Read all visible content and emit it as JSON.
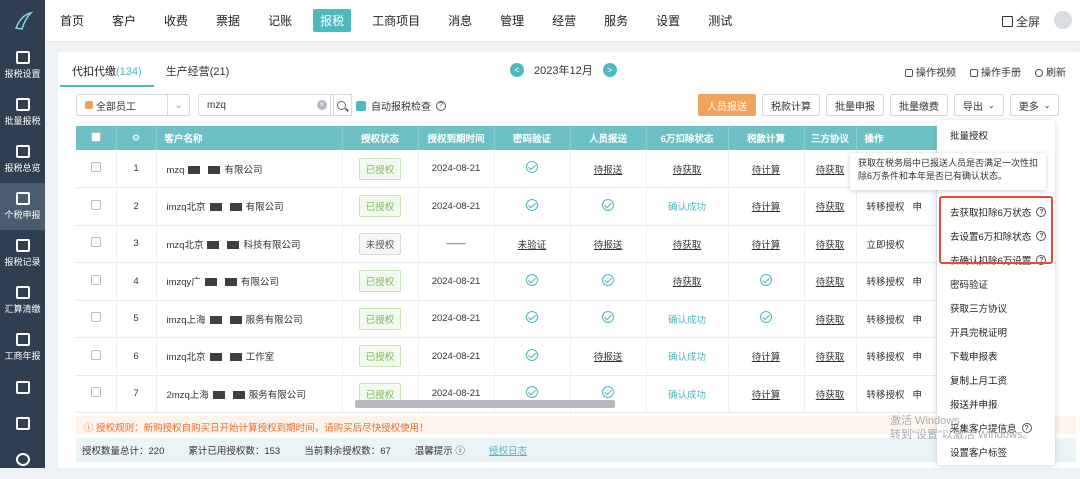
{
  "sidebar": {
    "items": [
      {
        "label": "报税设置",
        "icon": "monitor-gear-icon"
      },
      {
        "label": "批量报税",
        "icon": "monitor-download-icon"
      },
      {
        "label": "报税总览",
        "icon": "document-icon"
      },
      {
        "label": "个税申报",
        "icon": "person-tax-icon"
      },
      {
        "label": "报税记录",
        "icon": "record-list-icon"
      },
      {
        "label": "汇算清缴",
        "icon": "calculator-icon"
      },
      {
        "label": "工商年报",
        "icon": "calendar-report-icon"
      },
      {
        "label": "",
        "icon": "terminal-icon"
      },
      {
        "label": "",
        "icon": "download-icon"
      },
      {
        "label": "",
        "icon": "headset-icon"
      }
    ]
  },
  "topnav": {
    "items": [
      "首页",
      "客户",
      "收费",
      "票据",
      "记账",
      "报税",
      "工商项目",
      "消息",
      "管理",
      "经营",
      "服务",
      "设置",
      "测试"
    ],
    "active_index": 5,
    "fullscreen_label": "全屏"
  },
  "tabs": [
    {
      "label": "代扣代缴",
      "count": "(134)"
    },
    {
      "label": "生产经营",
      "count": "(21)"
    }
  ],
  "date_nav": {
    "label": "2023年12月",
    "prev": "<",
    "next": ">"
  },
  "top_links": [
    "操作视频",
    "操作手册",
    "刷新"
  ],
  "filter": {
    "staff_select": "全部员工",
    "search_value": "mzq",
    "auto_check_label": "自动报税检查"
  },
  "buttons": {
    "report_staff": "人员报送",
    "calc_tax": "税款计算",
    "batch_declare": "批量申报",
    "batch_pay": "批量缴费",
    "export": "导出",
    "more": "更多"
  },
  "table": {
    "headers": [
      "客户名称",
      "授权状态",
      "授权到期时间",
      "密码验证",
      "人员报送",
      "6万扣除状态",
      "税款计算",
      "三方协议",
      "操作"
    ],
    "rows": [
      {
        "no": "1",
        "name_prefix": "mzq",
        "name_suffix": "有限公司",
        "auth": "已授权",
        "expire": "2024-08-21",
        "pwd": "ok",
        "staff": "待报送",
        "deduct": "待获取",
        "tax": "待计算",
        "third": "待获取",
        "op": "",
        "op2": ""
      },
      {
        "no": "2",
        "name_prefix": "imzq北京",
        "name_suffix": "有限公司",
        "auth": "已授权",
        "expire": "2024-08-21",
        "pwd": "ok",
        "staff": "ok",
        "deduct": "确认成功",
        "tax": "待计算",
        "third": "待获取",
        "op": "转移授权",
        "op2": "申"
      },
      {
        "no": "3",
        "name_prefix": "mzq北京",
        "name_suffix": "科技有限公司",
        "auth": "未授权",
        "expire": "——",
        "pwd": "未验证",
        "staff": "待报送",
        "deduct": "待获取",
        "tax": "待计算",
        "third": "待获取",
        "op": "立即授权",
        "op2": ""
      },
      {
        "no": "4",
        "name_prefix": "imzqy广",
        "name_suffix": "有限公司",
        "auth": "已授权",
        "expire": "2024-08-21",
        "pwd": "ok",
        "staff": "ok",
        "deduct": "待获取",
        "tax": "ok",
        "third": "待获取",
        "op": "转移授权",
        "op2": "申"
      },
      {
        "no": "5",
        "name_prefix": "imzq上海",
        "name_suffix": "服务有限公司",
        "auth": "已授权",
        "expire": "2024-08-21",
        "pwd": "ok",
        "staff": "ok",
        "deduct": "确认成功",
        "tax": "ok",
        "third": "待获取",
        "op": "转移授权",
        "op2": "申"
      },
      {
        "no": "6",
        "name_prefix": "imzq北京",
        "name_suffix": "工作室",
        "auth": "已授权",
        "expire": "2024-08-21",
        "pwd": "ok",
        "staff": "待报送",
        "deduct": "确认成功",
        "tax": "待计算",
        "third": "待获取",
        "op": "转移授权",
        "op2": "申"
      },
      {
        "no": "7",
        "name_prefix": "2mzq上海",
        "name_suffix": "服务有限公司",
        "auth": "已授权",
        "expire": "2024-08-21",
        "pwd": "ok",
        "staff": "ok",
        "deduct": "确认成功",
        "tax": "待计算",
        "third": "待获取",
        "op": "转移授权",
        "op2": "申"
      }
    ]
  },
  "rule_note": "ⓘ 授权规则：新购授权自购买日开始计算授权到期时间，请购买后尽快授权使用！",
  "bottom": {
    "total": "授权数量总计：220",
    "used": "累计已用授权数：153",
    "remain": "当前剩余授权数：67",
    "tip": "温馨提示 ⓘ",
    "log": "授权日志"
  },
  "dropdown": {
    "items": [
      "批量授权",
      "",
      "",
      "去获取扣除6万状态",
      "去设置6万扣除状态",
      "去确认扣除6万设置",
      "密码验证",
      "获取三方协议",
      "开具完税证明",
      "下载申报表",
      "复制上月工资",
      "报送并申报",
      "采集客户提信息",
      "设置客户标签"
    ]
  },
  "tooltip": "获取在税务局中已报送人员是否满足一次性扣除6万条件和本年是否已有确认状态。",
  "watermark": {
    "line1": "激活 Windows",
    "line2": "转到\"设置\"以激活 Windows。"
  },
  "colors": {
    "accent": "#4db8be",
    "sidebar": "#2f3e50",
    "primary_btn": "#f0a35b",
    "highlight": "#e24a3b",
    "warn": "#e86b2d"
  }
}
